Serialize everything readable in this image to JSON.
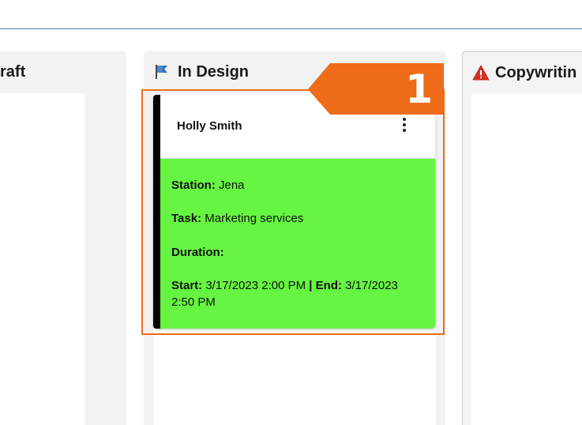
{
  "board": {
    "columns": [
      {
        "title": "raft",
        "icon": "none"
      },
      {
        "title": "In Design",
        "icon": "flag-icon"
      },
      {
        "title": "Copywritin",
        "icon": "warning-icon"
      }
    ]
  },
  "card": {
    "name": "Holly Smith",
    "station_label": "Station:",
    "station_value": "Jena",
    "task_label": "Task:",
    "task_value": "Marketing services",
    "duration_label": "Duration:",
    "start_label": "Start:",
    "start_value": "3/17/2023 2:00 PM",
    "separator": "|",
    "end_label": "End:",
    "end_value": "3/17/2023 2:50 PM",
    "body_color": "#66f542",
    "stripe_color": "#000000"
  },
  "annotation": {
    "number": "1",
    "color": "#ef6c1a"
  }
}
